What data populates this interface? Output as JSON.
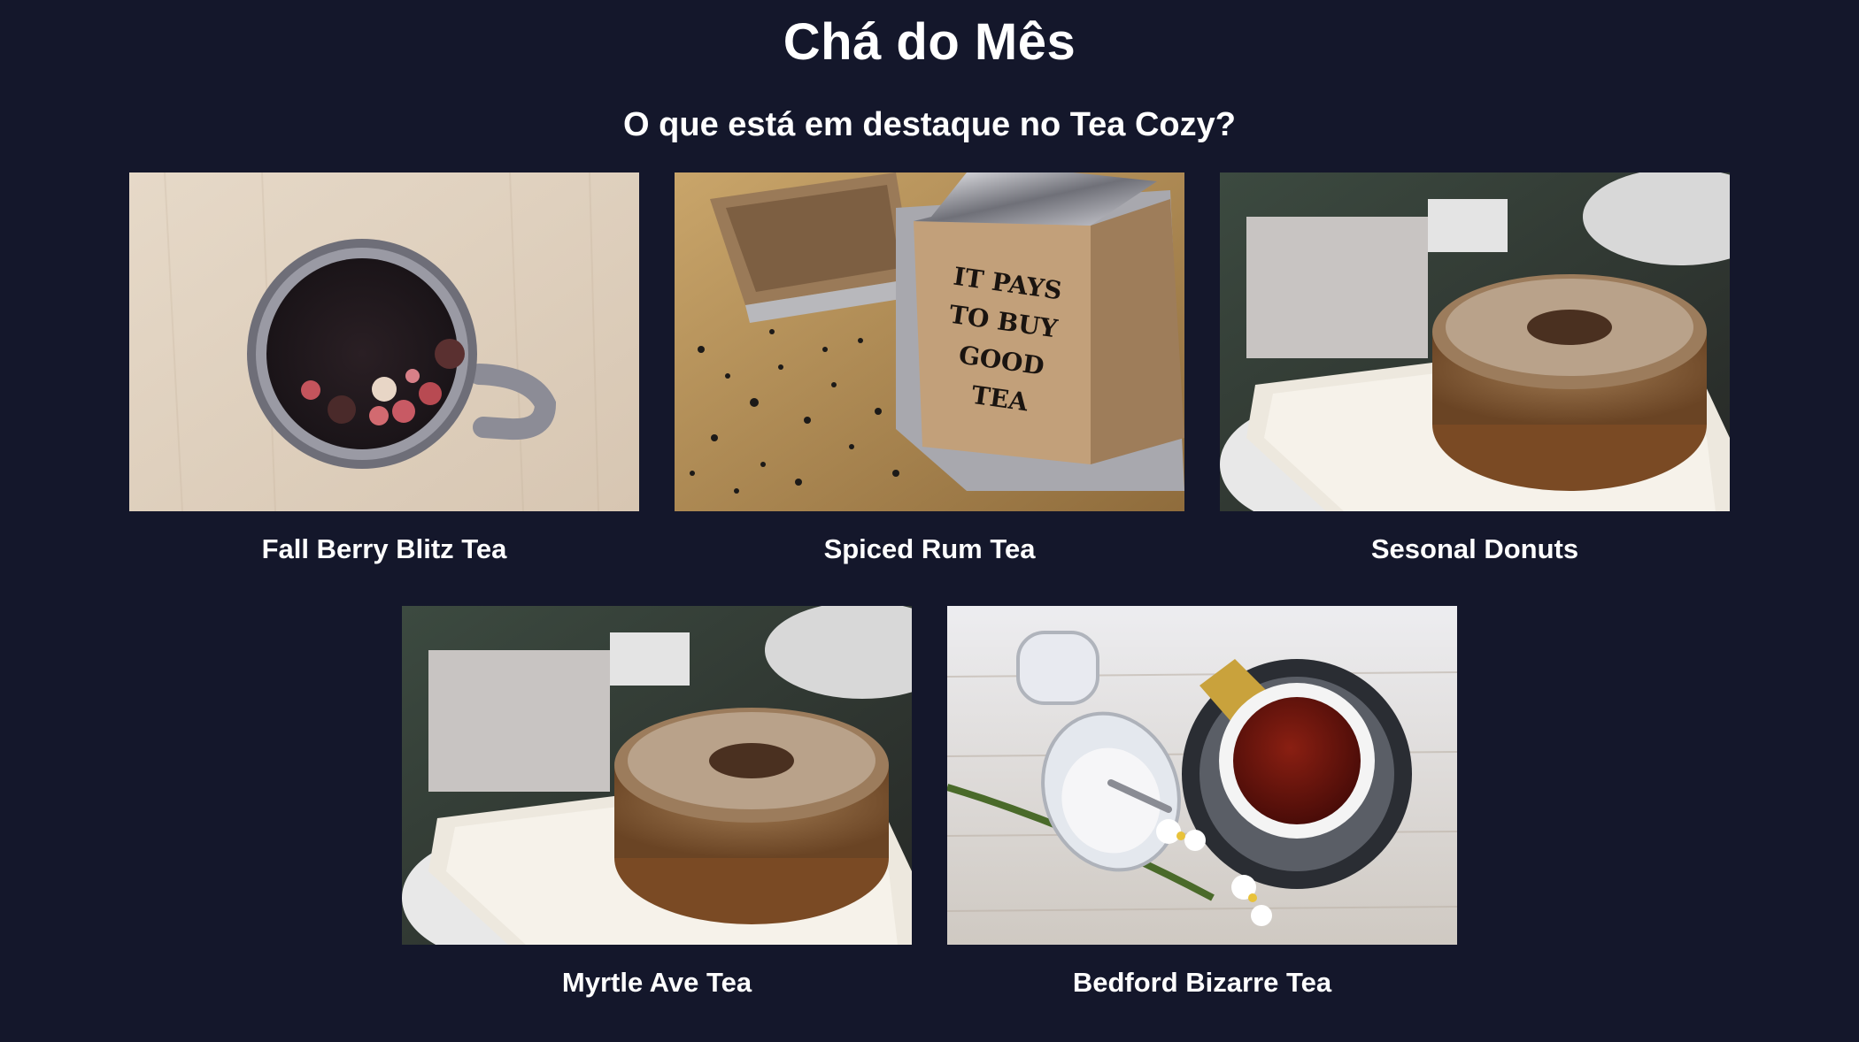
{
  "header": {
    "title": "Chá do Mês",
    "subtitle": "O que está em destaque no Tea Cozy?"
  },
  "products": [
    {
      "name": "Fall Berry Blitz Tea",
      "image": "mug-with-berries-photo"
    },
    {
      "name": "Spiced Rum Tea",
      "image": "tea-crate-photo",
      "crate_text": [
        "IT PAYS",
        "TO BUY",
        "GOOD",
        "TEA"
      ]
    },
    {
      "name": "Sesonal Donuts",
      "image": "donut-photo"
    },
    {
      "name": "Myrtle Ave Tea",
      "image": "donut-photo"
    },
    {
      "name": "Bedford Bizarre Tea",
      "image": "teacup-and-jar-photo"
    }
  ],
  "colors": {
    "background": "#14172b",
    "text": "#ffffff"
  }
}
